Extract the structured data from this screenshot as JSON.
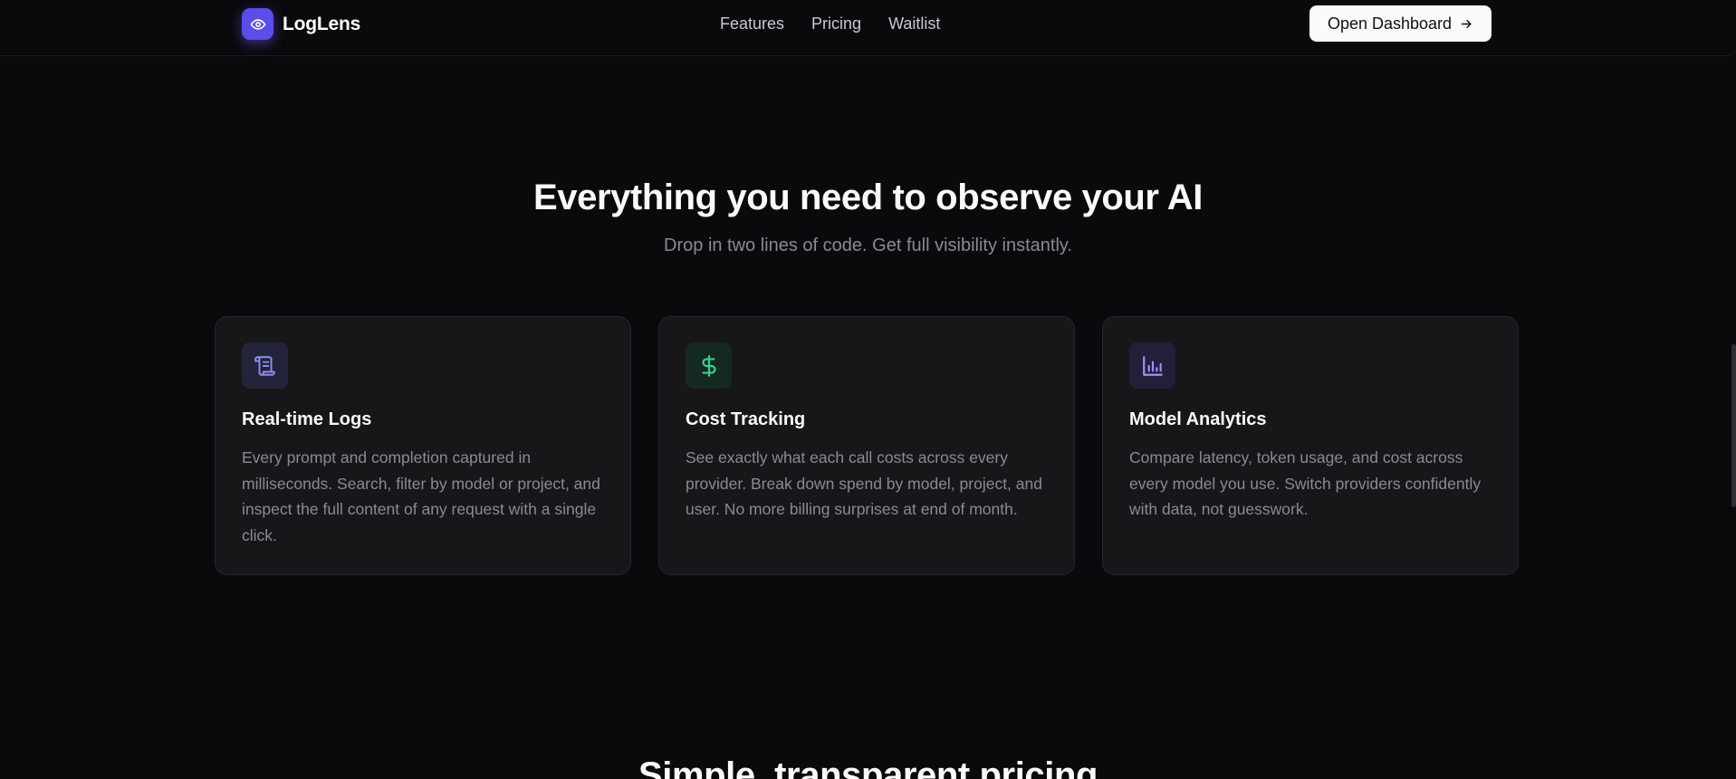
{
  "brand": {
    "name": "LogLens",
    "logo_icon": "eye-icon",
    "accent": "#5b4de8"
  },
  "nav": {
    "links": [
      {
        "label": "Features"
      },
      {
        "label": "Pricing"
      },
      {
        "label": "Waitlist"
      }
    ],
    "cta_label": "Open Dashboard",
    "cta_icon": "arrow-right-icon"
  },
  "features": {
    "title": "Everything you need to observe your AI",
    "subtitle": "Drop in two lines of code. Get full visibility instantly.",
    "cards": [
      {
        "icon": "scroll-icon",
        "icon_color": "#8b8cf5",
        "icon_bg": "#23233a",
        "title": "Real-time Logs",
        "description": "Every prompt and completion captured in milliseconds. Search, filter by model or project, and inspect the full content of any request with a single click."
      },
      {
        "icon": "dollar-icon",
        "icon_color": "#34d399",
        "icon_bg": "#14291f",
        "title": "Cost Tracking",
        "description": "See exactly what each call costs across every provider. Break down spend by model, project, and user. No more billing surprises at end of month."
      },
      {
        "icon": "bar-chart-icon",
        "icon_color": "#a78bfa",
        "icon_bg": "#241f38",
        "title": "Model Analytics",
        "description": "Compare latency, token usage, and cost across every model you use. Switch providers confidently with data, not guesswork."
      }
    ]
  },
  "pricing": {
    "title": "Simple, transparent pricing"
  }
}
